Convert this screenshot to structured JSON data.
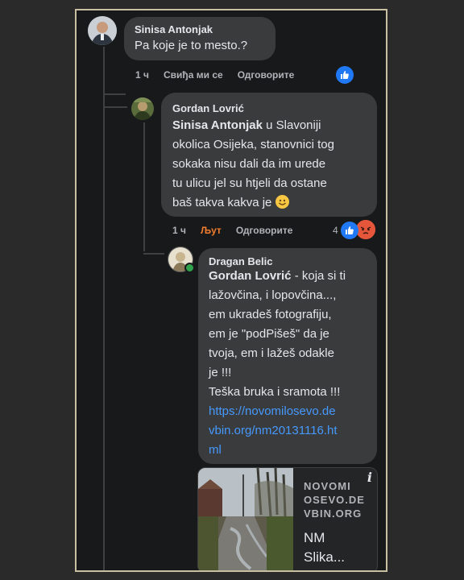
{
  "comment1": {
    "author": "Sinisa Antonjak",
    "text": "Pa koje je to mesto.?",
    "time": "1 ч",
    "like_label": "Свиђа ми се",
    "reply_label": "Одговорите"
  },
  "comment2": {
    "author": "Gordan Lovrić",
    "mention": "Sinisa Antonjak",
    "lines": [
      " u Slavoniji",
      "okolica Osijeka, stanovnici tog",
      "sokaka nisu dali da im urede",
      "tu ulicu jel su htjeli da ostane",
      "baš takva kakva je "
    ],
    "time": "1 ч",
    "like_label": "Љут",
    "reply_label": "Одговорите",
    "reaction_count": "4"
  },
  "comment3": {
    "author": "Dragan Belic",
    "mention": "Gordan Lovrić",
    "lines": [
      " - koja si ti",
      "lažovčina, i lopovčina...,",
      "em ukradeš fotografiju,",
      "em je \"podPišeš\" da je",
      "tvoja, em i lažeš odakle",
      "je !!!",
      "Teška bruka i sramota !!!"
    ],
    "link_lines": [
      "https://novomilosevo.de",
      "vbin.org/nm20131116.ht",
      "ml"
    ]
  },
  "preview": {
    "site_lines": [
      "NOVOMI",
      "OSEVO.DE",
      "VBIN.ORG"
    ],
    "title_lines": [
      "NM",
      "Slika..."
    ],
    "info_icon": "i"
  },
  "colors": {
    "like_blue": "#2078f4",
    "angry_orange": "#e5563a",
    "link": "#4599ff",
    "angry_label": "#f07d2e"
  }
}
